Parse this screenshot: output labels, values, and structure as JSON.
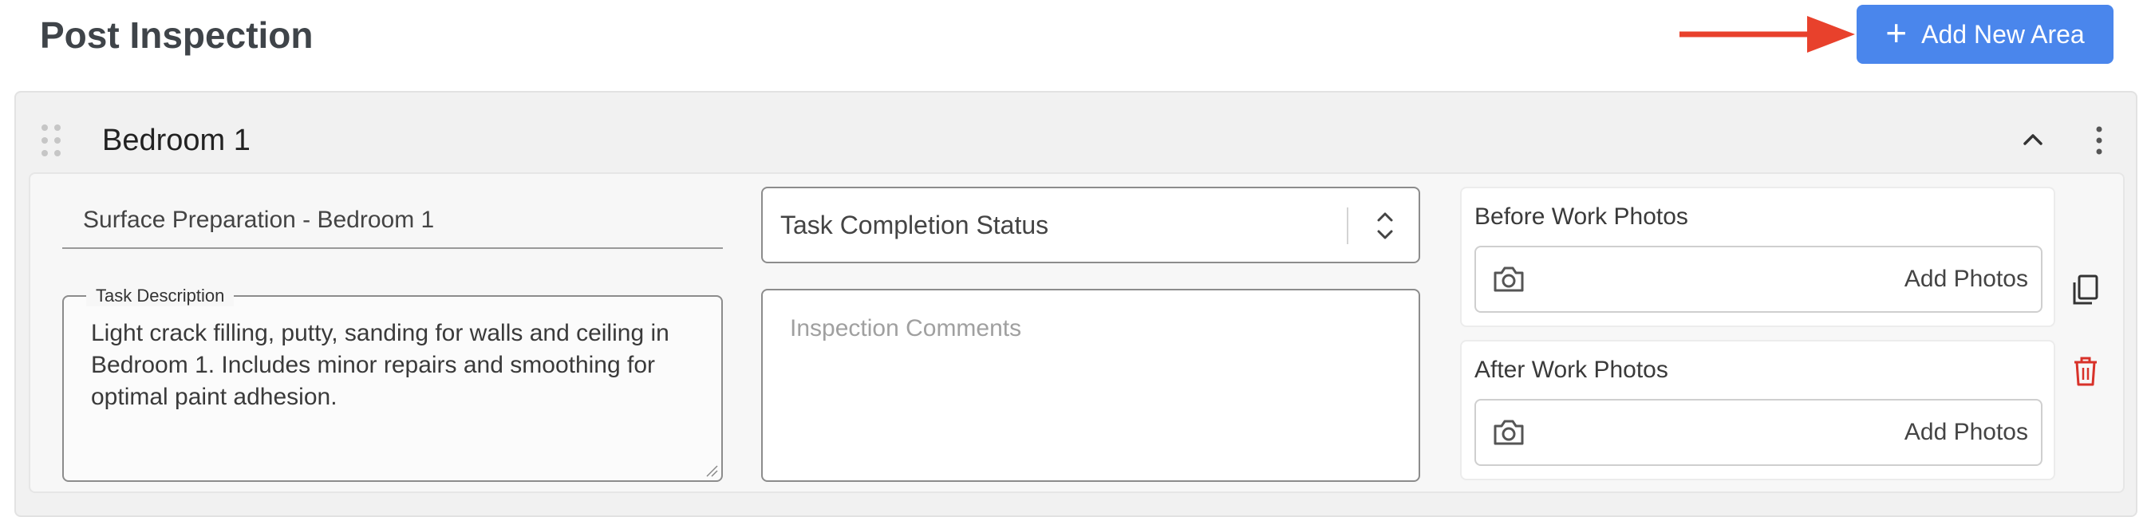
{
  "header": {
    "title": "Post Inspection",
    "add_area_label": "Add New Area",
    "add_area_icon": "plus-icon",
    "arrow_color": "#e8412c",
    "accent_color": "#4a86ec"
  },
  "area": {
    "name": "Bedroom 1",
    "icons": [
      "drag-handle-icon",
      "chevron-up-icon",
      "more-vertical-icon"
    ],
    "task": {
      "title": "Surface Preparation - Bedroom 1",
      "description_label": "Task Description",
      "description": "Light crack filling, putty, sanding for walls and ceiling in Bedroom 1. Includes minor repairs and smoothing for optimal paint adhesion.",
      "status_placeholder": "Task Completion Status",
      "comments_placeholder": "Inspection Comments",
      "before_photos_label": "Before Work Photos",
      "after_photos_label": "After Work Photos",
      "add_photos_label": "Add Photos",
      "actions": [
        "copy-icon",
        "delete-icon"
      ],
      "delete_color": "#d8322a"
    }
  }
}
